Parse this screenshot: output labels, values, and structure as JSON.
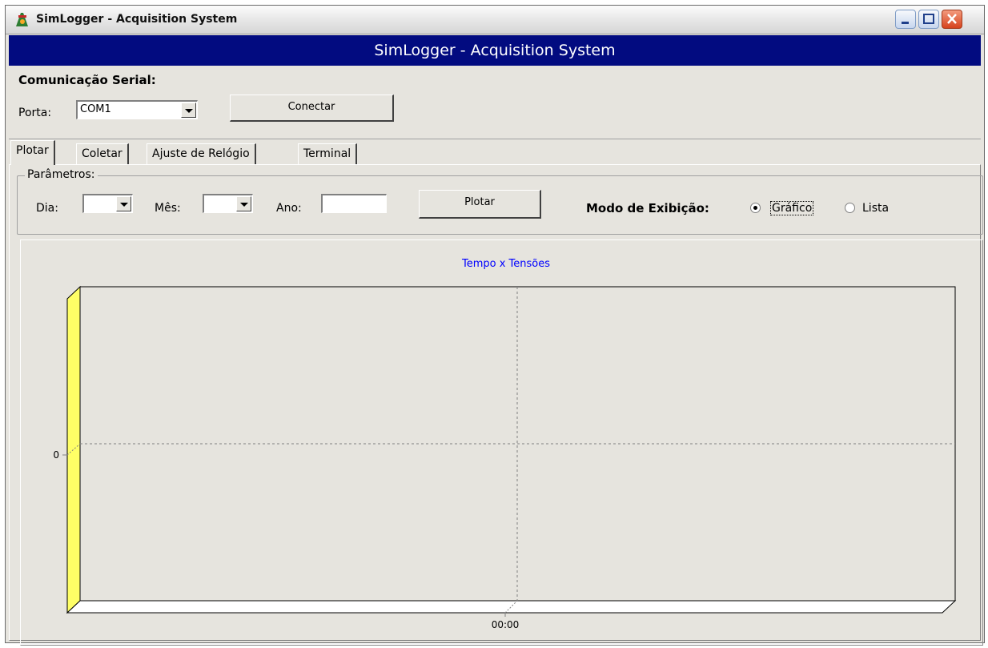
{
  "window": {
    "title": "SimLogger - Acquisition System",
    "icon": "app-logo-icon"
  },
  "banner": {
    "title": "SimLogger - Acquisition System"
  },
  "serial": {
    "section_title": "Comunicação Serial:",
    "port_label": "Porta:",
    "port_value": "COM1",
    "connect_button": "Conectar"
  },
  "tabs": [
    {
      "label": "Plotar",
      "active": true
    },
    {
      "label": "Coletar",
      "active": false
    },
    {
      "label": "Ajuste de Relógio",
      "active": false
    },
    {
      "label": "Terminal",
      "active": false
    }
  ],
  "params": {
    "legend": "Parâmetros:",
    "day_label": "Dia:",
    "day_value": "",
    "month_label": "Mês:",
    "month_value": "",
    "year_label": "Ano:",
    "year_value": "",
    "plot_button": "Plotar",
    "mode_label": "Modo de Exibição:",
    "mode_options": [
      {
        "label": "Gráfico",
        "selected": true
      },
      {
        "label": "Lista",
        "selected": false
      }
    ]
  },
  "chart_data": {
    "type": "line",
    "title": "Tempo x Tensões",
    "xlabel": "",
    "ylabel": "",
    "x_tick_labels": [
      "00:00"
    ],
    "y_tick_labels": [
      "0"
    ],
    "series": [],
    "grid": true,
    "colors": {
      "title": "#0000ff",
      "wall": "#ffff66",
      "banner": "#020b80"
    }
  }
}
